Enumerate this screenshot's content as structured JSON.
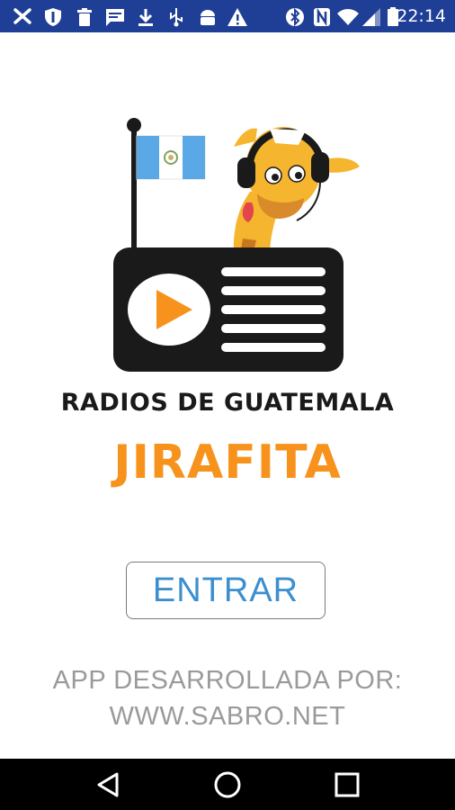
{
  "status_bar": {
    "time": "22:14",
    "background": "#1f3f97",
    "left_icons": [
      "tools-icon",
      "shield-icon",
      "delete-icon",
      "message-icon",
      "download-icon",
      "usb-icon",
      "android-icon",
      "warning-icon"
    ],
    "right_icons": [
      "bluetooth-icon",
      "nfc-icon",
      "wifi-icon",
      "signal-icon",
      "battery-icon"
    ]
  },
  "logo": {
    "flag_colors": [
      "#5aa9e6",
      "#ffffff",
      "#5aa9e6"
    ],
    "play_color": "#f7931d",
    "radio_color": "#1a1a1a",
    "giraffe_color": "#f5b52e"
  },
  "app": {
    "subtitle": "RADIOS DE GUATEMALA",
    "title": "JIRAFITA",
    "title_color": "#f7931d"
  },
  "enter_button": {
    "label": "ENTRAR",
    "color": "#3b8fcf"
  },
  "credits": {
    "line1": "APP DESARROLLADA POR:",
    "line2": "WWW.SABRO.NET"
  },
  "nav_bar": {
    "buttons": [
      "back-icon",
      "home-icon",
      "recents-icon"
    ]
  }
}
